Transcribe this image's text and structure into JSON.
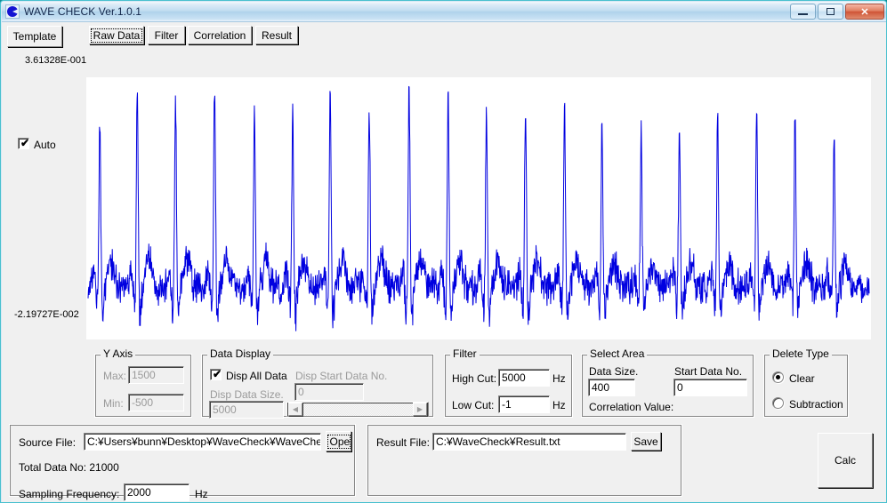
{
  "window": {
    "title": "WAVE CHECK Ver.1.0.1",
    "icon": "app-icon",
    "minimize_label": "",
    "maximize_label": "",
    "close_label": "✕",
    "border_color": "#49c0cf"
  },
  "toolbar": {
    "template_label": "Template",
    "tabs": [
      {
        "label": "Raw Data",
        "active": true
      },
      {
        "label": "Filter",
        "active": false
      },
      {
        "label": "Correlation",
        "active": false
      },
      {
        "label": "Result",
        "active": false
      }
    ]
  },
  "axis": {
    "max_label": "3.61328E-001",
    "min_label": "-2.19727E-002",
    "auto_label": "Auto",
    "auto_checked": true,
    "check_glyph": "✔"
  },
  "y_axis_group": {
    "title": "Y Axis",
    "max_label": "Max:",
    "max_value": "1500",
    "min_label": "Min:",
    "min_value": "-500",
    "enabled": false
  },
  "data_display_group": {
    "title": "Data Display",
    "disp_all_label": "Disp All Data",
    "disp_all_checked": true,
    "start_no_label": "Disp Start Data No.",
    "start_no_value": "0",
    "size_label": "Disp Data Size.",
    "size_value": "5000",
    "scroll_left_glyph": "◀",
    "scroll_right_glyph": "▶"
  },
  "filter_group": {
    "title": "Filter",
    "high_cut_label": "High Cut:",
    "high_cut_value": "5000",
    "high_cut_unit": "Hz",
    "low_cut_label": "Low Cut:",
    "low_cut_value": "-1",
    "low_cut_unit": "Hz"
  },
  "select_area_group": {
    "title": "Select Area",
    "data_size_label": "Data Size.",
    "data_size_value": "400",
    "start_no_label": "Start Data No.",
    "start_no_value": "0",
    "correlation_label": "Correlation Value:",
    "correlation_value": ""
  },
  "delete_type_group": {
    "title": "Delete Type",
    "options": [
      {
        "label": "Clear",
        "selected": true
      },
      {
        "label": "Subtraction",
        "selected": false
      }
    ]
  },
  "source_panel": {
    "source_label": "Source File:",
    "source_value": "C:¥Users¥bunn¥Desktop¥WaveCheck¥WaveCheck",
    "open_label": "Open",
    "total_data_label": "Total Data No: 21000",
    "sampling_label": "Sampling Frequency:",
    "sampling_value": "2000",
    "sampling_unit": "Hz"
  },
  "result_panel": {
    "result_label": "Result File:",
    "result_value": "C:¥WaveCheck¥Result.txt",
    "save_label": "Save"
  },
  "calc_button": {
    "label": "Calc"
  },
  "chart_data": {
    "type": "line",
    "title": "",
    "xlabel": "",
    "ylabel": "",
    "series_name": "Raw Data",
    "line_color": "#0000e0",
    "background": "#ffffff",
    "grid": false,
    "ylim": [
      -0.0219727,
      0.361328
    ],
    "ytick_labels": [
      "3.61328E-001",
      "-2.19727E-002"
    ],
    "total_points": 21000,
    "sampling_frequency_hz": 2000,
    "peak_count": 20,
    "peak_x_fraction": [
      0.015,
      0.063,
      0.112,
      0.162,
      0.213,
      0.262,
      0.31,
      0.36,
      0.411,
      0.461,
      0.51,
      0.56,
      0.61,
      0.658,
      0.708,
      0.757,
      0.806,
      0.856,
      0.905,
      0.955
    ],
    "peak_amplitude": [
      0.8,
      0.98,
      0.93,
      0.98,
      0.88,
      0.89,
      1.0,
      0.91,
      1.02,
      0.96,
      0.85,
      0.9,
      0.89,
      0.79,
      0.76,
      0.82,
      0.85,
      0.83,
      0.86,
      0.76
    ],
    "baseline_fraction": 0.8,
    "noise_amplitude": 0.07
  }
}
